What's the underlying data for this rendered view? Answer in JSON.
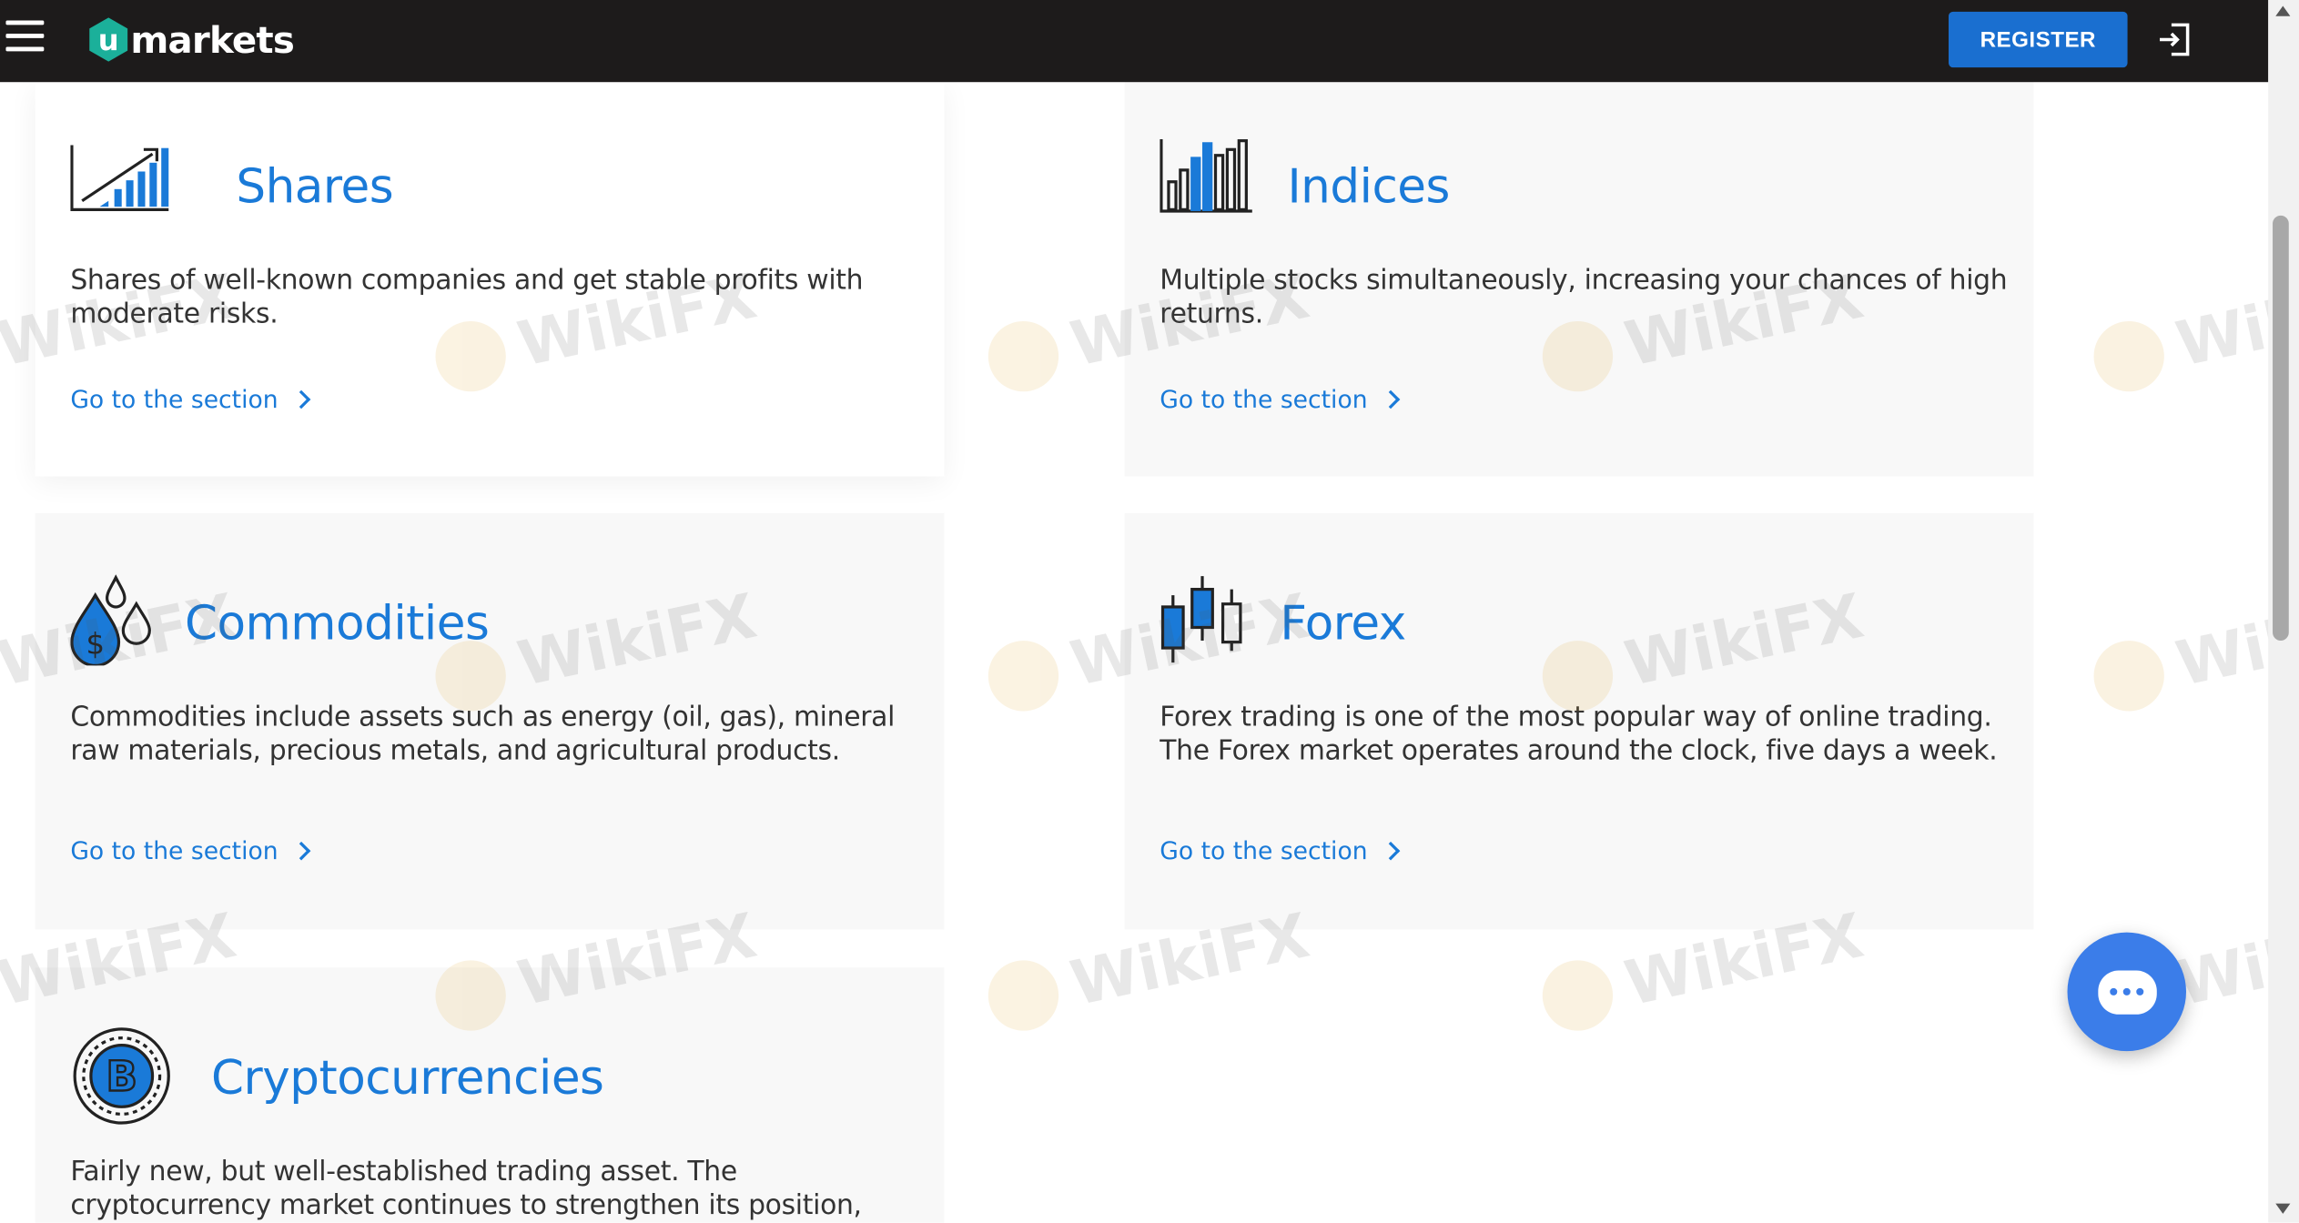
{
  "header": {
    "logo_text": "markets",
    "logo_letter": "u",
    "register_label": "REGISTER",
    "menu_icon": "hamburger-menu-icon",
    "login_icon": "login-icon"
  },
  "cards": [
    {
      "title": "Shares",
      "description": "Shares of well-known companies and get stable profits with moderate risks.",
      "link_label": "Go to the section",
      "icon": "rising-bar-chart-icon"
    },
    {
      "title": "Indices",
      "description": "Multiple stocks simultaneously, increasing your chances of high returns.",
      "link_label": "Go to the section",
      "icon": "bar-chart-icon"
    },
    {
      "title": "Commodities",
      "description": "Commodities include assets such as energy (oil, gas), mineral raw materials, precious metals, and agricultural products.",
      "link_label": "Go to the section",
      "icon": "oil-drops-dollar-icon"
    },
    {
      "title": "Forex",
      "description": "Forex trading is one of the most popular way of online trading. The Forex market operates around the clock, five days a week.",
      "link_label": "Go to the section",
      "icon": "candlestick-icon"
    },
    {
      "title": "Cryptocurrencies",
      "description": "Fairly new, but well-established trading asset. The cryptocurrency market continues to strengthen its position,",
      "icon": "bitcoin-coin-icon"
    }
  ],
  "watermark_text": "WikiFX",
  "chat": {
    "icon": "chat-bubble-icon"
  },
  "colors": {
    "accent": "#1a7ad8",
    "header_bg": "#1d1b1b",
    "register_bg": "#1a6fd0",
    "chat_bg": "#3b7de9",
    "logo_teal": "#1bb09a"
  }
}
